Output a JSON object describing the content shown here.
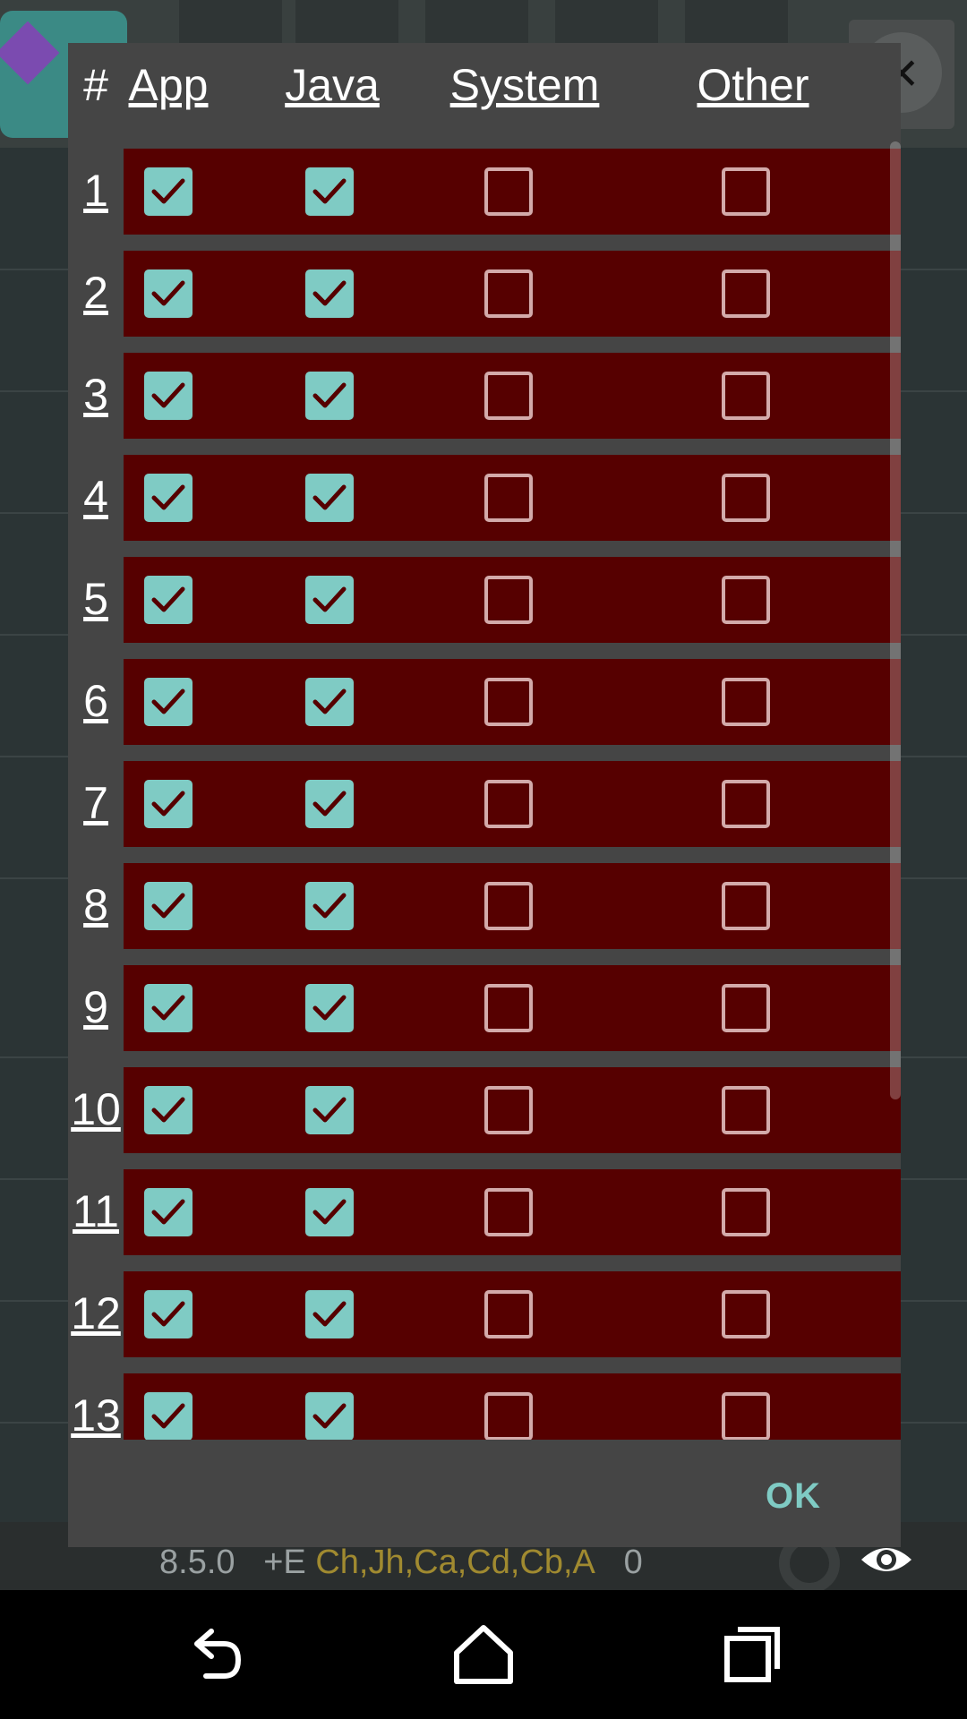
{
  "dialog": {
    "headers": {
      "hash": "#",
      "app": "App",
      "java": "Java",
      "system": "System",
      "other": "Other"
    },
    "ok_label": "OK",
    "rows": [
      {
        "num": "1",
        "app": true,
        "java": true,
        "system": false,
        "other": false
      },
      {
        "num": "2",
        "app": true,
        "java": true,
        "system": false,
        "other": false
      },
      {
        "num": "3",
        "app": true,
        "java": true,
        "system": false,
        "other": false
      },
      {
        "num": "4",
        "app": true,
        "java": true,
        "system": false,
        "other": false
      },
      {
        "num": "5",
        "app": true,
        "java": true,
        "system": false,
        "other": false
      },
      {
        "num": "6",
        "app": true,
        "java": true,
        "system": false,
        "other": false
      },
      {
        "num": "7",
        "app": true,
        "java": true,
        "system": false,
        "other": false
      },
      {
        "num": "8",
        "app": true,
        "java": true,
        "system": false,
        "other": false
      },
      {
        "num": "9",
        "app": true,
        "java": true,
        "system": false,
        "other": false
      },
      {
        "num": "10",
        "app": true,
        "java": true,
        "system": false,
        "other": false
      },
      {
        "num": "11",
        "app": true,
        "java": true,
        "system": false,
        "other": false
      },
      {
        "num": "12",
        "app": true,
        "java": true,
        "system": false,
        "other": false
      },
      {
        "num": "13",
        "app": true,
        "java": true,
        "system": false,
        "other": false
      }
    ]
  },
  "status_bar": {
    "version": "8.5.0",
    "flags": "+E",
    "regions": "Ch,Jh,Ca,Cd,Cb,A",
    "count": "0"
  },
  "colors": {
    "row_bg": "#560000",
    "checked": "#7fcbc4",
    "unchecked_border": "#d3aaaa",
    "ok": "#7fcbc4",
    "dialog": "#454545"
  },
  "icons": {
    "back": "back-icon",
    "home": "home-icon",
    "recents": "recents-icon",
    "eye": "eye-icon",
    "close": "close-icon",
    "gear": "gear-icon"
  }
}
